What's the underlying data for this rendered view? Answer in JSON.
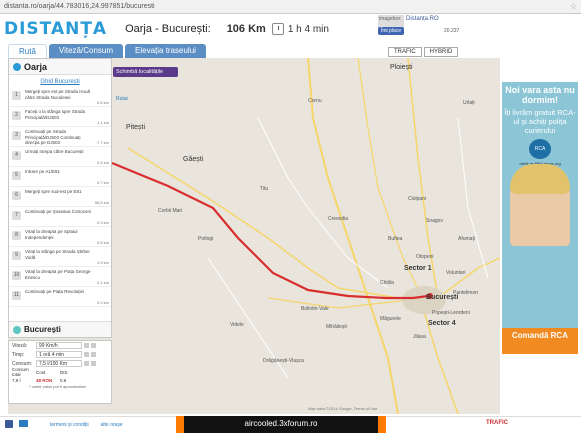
{
  "browser": {
    "url": "distanta.ro/oarja/44.783016,24.997851/bucuresti"
  },
  "header": {
    "logo": "DISTANȚA",
    "route_title": "Oarja - București:",
    "distance": "106 Km",
    "duration": "1 h 4 min"
  },
  "facebook": {
    "thumb_label": "imagebox",
    "page_name": "Distanța.RO",
    "like_label": "Îmi place",
    "like_count": "20.237"
  },
  "tabs": [
    {
      "label": "Rută"
    },
    {
      "label": "Viteză/Consum"
    },
    {
      "label": "Elevația traseului"
    }
  ],
  "map_controls": {
    "traffic": "TRAFIC",
    "hybrid": "HYBRID",
    "schimba": "Schimbă localitățile",
    "ruta": "Rutar"
  },
  "panel": {
    "origin": "Oarja",
    "guide_label": "Ghid București",
    "steps": [
      {
        "num": "1",
        "text": "Mergeți spre est pe Strada Houă către Strada Nuculesei",
        "dist": "0,6 km"
      },
      {
        "num": "2",
        "text": "Faceți o la stânga spre Strada Principală/DJ503",
        "dist": "1,1 km"
      },
      {
        "num": "3",
        "text": "Continuați pe Strada Principală/DJ503 Continuați direcția pe DJ503",
        "dist": "7,7 km"
      },
      {
        "num": "4",
        "text": "Urmați rampa către București",
        "dist": "0,4 km"
      },
      {
        "num": "5",
        "text": "Intrare pe A1/E81",
        "dist": "0,7 km"
      },
      {
        "num": "6",
        "text": "Mergeți spre sud-est pe E81",
        "dist": "96,5 km"
      },
      {
        "num": "7",
        "text": "Continuați pe Șoseaua Cotroceni",
        "dist": "0,3 km"
      },
      {
        "num": "8",
        "text": "Virați la dreapta pe Splaiul Independenței",
        "dist": "0,5 km"
      },
      {
        "num": "9",
        "text": "Virați la stânga pe Strada Știrbei Vodă",
        "dist": "1,9 km"
      },
      {
        "num": "10",
        "text": "Virați la dreapta pe Piața George Enescu",
        "dist": "0,1 km"
      },
      {
        "num": "11",
        "text": "Continuați pe Piața Revoluției",
        "dist": "0,2 km"
      }
    ],
    "destination": "București"
  },
  "stats": {
    "speed_label": "Viteză:",
    "speed_value": "99 Km/h",
    "time_label": "Timp:",
    "time_value": "1 oră 4 min",
    "consumption_label": "Consum:",
    "consumption_value": "7,5 l/100 Km",
    "head_total": "Consum total",
    "head_cost": "Cost",
    "head_dist": "DIS",
    "total_value": "7,9 l",
    "cost_value": "48 RON",
    "dist_value": "0.6",
    "note": "* unele valori pot fi aproximative"
  },
  "map": {
    "labels": [
      "Ploiești",
      "Pitești",
      "Găești",
      "Titu",
      "Bolintin-Vale",
      "Buftea",
      "Otopeni",
      "Voluntari",
      "Pantelimon",
      "Popești-Leordeni",
      "Măgurele",
      "Jilava",
      "Chitila",
      "Mihăilești",
      "Drăgănești-Vlașca",
      "Videle",
      "Sector 1",
      "Sector 4",
      "București",
      "Cornu",
      "Urlați",
      "Crevedia",
      "Corbii Mari",
      "Potlogi",
      "Ciolpani",
      "Snagov",
      "Afumați"
    ],
    "copyright": "Map data ©2014 Google, Terms of Use"
  },
  "ad": {
    "title": "Noi vara asta nu dormim!",
    "text": "Îți livrăm gratuit RCA-ul și achiți polița curierului",
    "badge": "RCA",
    "sponsor": "oferit de PBA prime.org",
    "cta": "Comandă RCA"
  },
  "footer": {
    "links": [
      "termeni și condiții",
      "alte orașe"
    ],
    "traffic_brand": "TRAFIC"
  },
  "watermark": "aircooled.3xforum.ro"
}
